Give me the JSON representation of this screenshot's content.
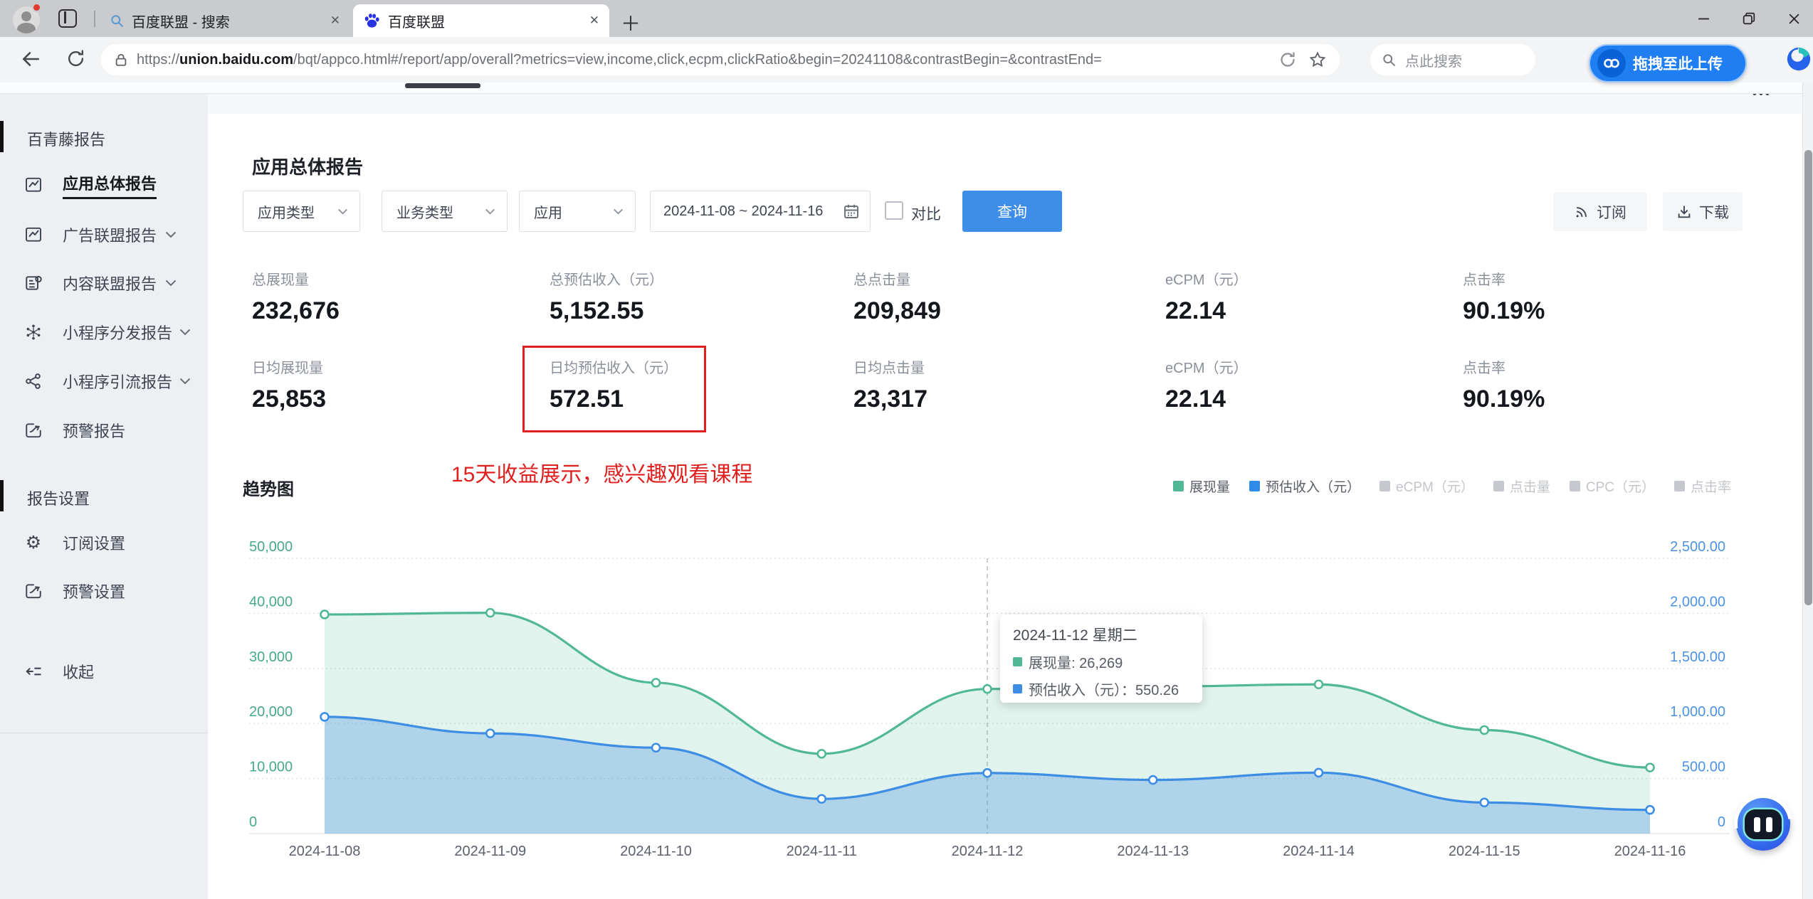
{
  "browser": {
    "tabs": [
      {
        "title": "百度联盟 - 搜索"
      },
      {
        "title": "百度联盟"
      }
    ],
    "url": {
      "scheme": "https://",
      "domain": "union.baidu.com",
      "path": "/bqt/appco.html#/report/app/overall?metrics=view,income,click,ecpm,clickRatio&begin=20241108&contrastBegin=&contrastEnd="
    },
    "search_placeholder": "点此搜索",
    "upload_label": "拖拽至此上传"
  },
  "sidebar": {
    "section_report": "百青藤报告",
    "items": [
      {
        "label": "应用总体报告"
      },
      {
        "label": "广告联盟报告"
      },
      {
        "label": "内容联盟报告"
      },
      {
        "label": "小程序分发报告"
      },
      {
        "label": "小程序引流报告"
      },
      {
        "label": "预警报告"
      }
    ],
    "section_settings": "报告设置",
    "subscribe_setting": "订阅设置",
    "alert_setting": "预警设置",
    "collapse": "收起"
  },
  "main": {
    "title": "应用总体报告",
    "filters": {
      "app_type": "应用类型",
      "biz_type": "业务类型",
      "app": "应用",
      "date_range": "2024-11-08 ~ 2024-11-16",
      "compare": "对比",
      "query": "查询",
      "subscribe": "订阅",
      "download": "下载"
    },
    "stats": {
      "rows": [
        [
          {
            "label": "总展现量",
            "value": "232,676"
          },
          {
            "label": "总预估收入（元）",
            "value": "5,152.55"
          },
          {
            "label": "总点击量",
            "value": "209,849"
          },
          {
            "label": "eCPM（元）",
            "value": "22.14"
          },
          {
            "label": "点击率",
            "value": "90.19%"
          }
        ],
        [
          {
            "label": "日均展现量",
            "value": "25,853"
          },
          {
            "label": "日均预估收入（元）",
            "value": "572.51"
          },
          {
            "label": "日均点击量",
            "value": "23,317"
          },
          {
            "label": "eCPM（元）",
            "value": "22.14"
          },
          {
            "label": "点击率",
            "value": "90.19%"
          }
        ]
      ]
    },
    "annotation": "15天收益展示，感兴趣观看课程",
    "chart_title": "趋势图"
  },
  "chart_data": {
    "type": "area",
    "x": [
      "2024-11-08",
      "2024-11-09",
      "2024-11-10",
      "2024-11-11",
      "2024-11-12",
      "2024-11-13",
      "2024-11-14",
      "2024-11-15",
      "2024-11-16"
    ],
    "series": [
      {
        "name": "展现量",
        "axis": "left",
        "color": "#50b894",
        "fill": "rgba(80,184,148,0.17)",
        "values": [
          39800,
          40100,
          27400,
          14500,
          26269,
          26700,
          27100,
          18800,
          12000
        ]
      },
      {
        "name": "预估收入（元）",
        "axis": "right",
        "color": "#3d8de5",
        "fill": "rgba(61,141,229,0.30)",
        "values": [
          1060,
          910,
          780,
          315,
          550.26,
          487,
          553,
          282,
          215
        ]
      }
    ],
    "left_axis": {
      "ticks": [
        "50,000",
        "40,000",
        "30,000",
        "20,000",
        "10,000",
        "0"
      ],
      "max": 50000,
      "color": "#47a98c"
    },
    "right_axis": {
      "ticks": [
        "2,500.00",
        "2,000.00",
        "1,500.00",
        "1,000.00",
        "500.00",
        "0"
      ],
      "max": 2500,
      "color": "#4b92e4"
    },
    "legend": [
      {
        "label": "展现量",
        "color": "#50b894",
        "active": true
      },
      {
        "label": "预估收入（元）",
        "color": "#2e8ce8",
        "active": true
      },
      {
        "label": "eCPM（元）",
        "color": "#c5c8cd",
        "active": false
      },
      {
        "label": "点击量",
        "color": "#c5c8cd",
        "active": false
      },
      {
        "label": "CPC（元）",
        "color": "#c5c8cd",
        "active": false
      },
      {
        "label": "点击率",
        "color": "#c5c8cd",
        "active": false
      }
    ],
    "highlight_index": 4,
    "grid": true,
    "legend_position": "top-right"
  },
  "tooltip": {
    "title": "2024-11-12 星期二",
    "rows": [
      {
        "color": "#50b894",
        "text": "展现量: 26,269"
      },
      {
        "color": "#3d8de5",
        "text": "预估收入（元）：550.26"
      }
    ]
  }
}
